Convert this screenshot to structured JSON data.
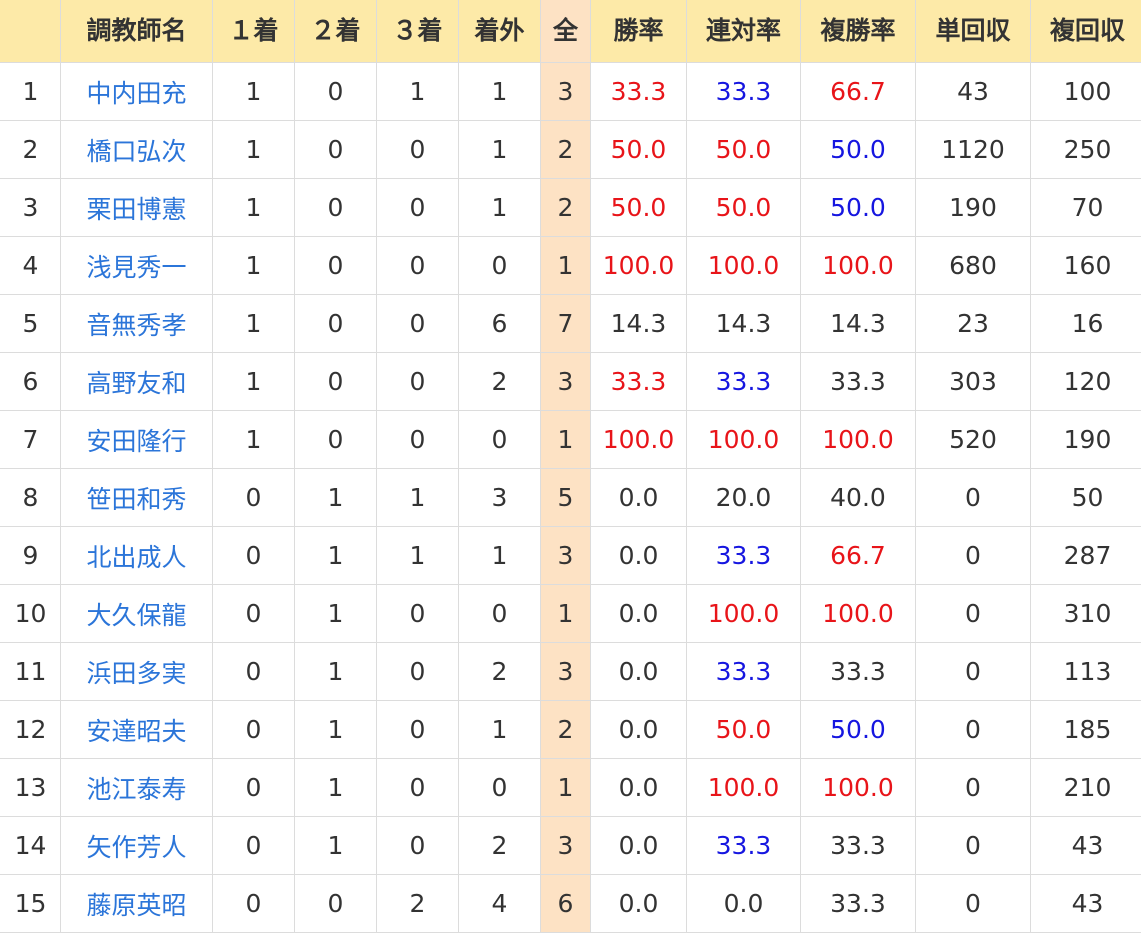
{
  "table": {
    "headers": {
      "rank": "",
      "trainer": "調教師名",
      "first": "１着",
      "second": "２着",
      "third": "３着",
      "out": "着外",
      "total": "全",
      "win_rate": "勝率",
      "quinella_rate": "連対率",
      "place_rate": "複勝率",
      "win_return": "単回収",
      "place_return": "複回収"
    },
    "colors": {
      "header_bg": "#fdeaa8",
      "total_column_bg": "#fde2c4",
      "link": "#2b75d9",
      "red": "#e81419",
      "blue": "#1616e0",
      "text": "#333333"
    },
    "rows": [
      {
        "rank": "1",
        "trainer": "中内田充",
        "first": "1",
        "second": "0",
        "third": "1",
        "out": "1",
        "total": "3",
        "win_rate": "33.3",
        "quinella_rate": "33.3",
        "place_rate": "66.7",
        "win_return": "43",
        "place_return": "100"
      },
      {
        "rank": "2",
        "trainer": "橋口弘次",
        "first": "1",
        "second": "0",
        "third": "0",
        "out": "1",
        "total": "2",
        "win_rate": "50.0",
        "quinella_rate": "50.0",
        "place_rate": "50.0",
        "win_return": "1120",
        "place_return": "250"
      },
      {
        "rank": "3",
        "trainer": "栗田博憲",
        "first": "1",
        "second": "0",
        "third": "0",
        "out": "1",
        "total": "2",
        "win_rate": "50.0",
        "quinella_rate": "50.0",
        "place_rate": "50.0",
        "win_return": "190",
        "place_return": "70"
      },
      {
        "rank": "4",
        "trainer": "浅見秀一",
        "first": "1",
        "second": "0",
        "third": "0",
        "out": "0",
        "total": "1",
        "win_rate": "100.0",
        "quinella_rate": "100.0",
        "place_rate": "100.0",
        "win_return": "680",
        "place_return": "160"
      },
      {
        "rank": "5",
        "trainer": "音無秀孝",
        "first": "1",
        "second": "0",
        "third": "0",
        "out": "6",
        "total": "7",
        "win_rate": "14.3",
        "quinella_rate": "14.3",
        "place_rate": "14.3",
        "win_return": "23",
        "place_return": "16"
      },
      {
        "rank": "6",
        "trainer": "高野友和",
        "first": "1",
        "second": "0",
        "third": "0",
        "out": "2",
        "total": "3",
        "win_rate": "33.3",
        "quinella_rate": "33.3",
        "place_rate": "33.3",
        "win_return": "303",
        "place_return": "120"
      },
      {
        "rank": "7",
        "trainer": "安田隆行",
        "first": "1",
        "second": "0",
        "third": "0",
        "out": "0",
        "total": "1",
        "win_rate": "100.0",
        "quinella_rate": "100.0",
        "place_rate": "100.0",
        "win_return": "520",
        "place_return": "190"
      },
      {
        "rank": "8",
        "trainer": "笹田和秀",
        "first": "0",
        "second": "1",
        "third": "1",
        "out": "3",
        "total": "5",
        "win_rate": "0.0",
        "quinella_rate": "20.0",
        "place_rate": "40.0",
        "win_return": "0",
        "place_return": "50"
      },
      {
        "rank": "9",
        "trainer": "北出成人",
        "first": "0",
        "second": "1",
        "third": "1",
        "out": "1",
        "total": "3",
        "win_rate": "0.0",
        "quinella_rate": "33.3",
        "place_rate": "66.7",
        "win_return": "0",
        "place_return": "287"
      },
      {
        "rank": "10",
        "trainer": "大久保龍",
        "first": "0",
        "second": "1",
        "third": "0",
        "out": "0",
        "total": "1",
        "win_rate": "0.0",
        "quinella_rate": "100.0",
        "place_rate": "100.0",
        "win_return": "0",
        "place_return": "310"
      },
      {
        "rank": "11",
        "trainer": "浜田多実",
        "first": "0",
        "second": "1",
        "third": "0",
        "out": "2",
        "total": "3",
        "win_rate": "0.0",
        "quinella_rate": "33.3",
        "place_rate": "33.3",
        "win_return": "0",
        "place_return": "113"
      },
      {
        "rank": "12",
        "trainer": "安達昭夫",
        "first": "0",
        "second": "1",
        "third": "0",
        "out": "1",
        "total": "2",
        "win_rate": "0.0",
        "quinella_rate": "50.0",
        "place_rate": "50.0",
        "win_return": "0",
        "place_return": "185"
      },
      {
        "rank": "13",
        "trainer": "池江泰寿",
        "first": "0",
        "second": "1",
        "third": "0",
        "out": "0",
        "total": "1",
        "win_rate": "0.0",
        "quinella_rate": "100.0",
        "place_rate": "100.0",
        "win_return": "0",
        "place_return": "210"
      },
      {
        "rank": "14",
        "trainer": "矢作芳人",
        "first": "0",
        "second": "1",
        "third": "0",
        "out": "2",
        "total": "3",
        "win_rate": "0.0",
        "quinella_rate": "33.3",
        "place_rate": "33.3",
        "win_return": "0",
        "place_return": "43"
      },
      {
        "rank": "15",
        "trainer": "藤原英昭",
        "first": "0",
        "second": "0",
        "third": "2",
        "out": "4",
        "total": "6",
        "win_rate": "0.0",
        "quinella_rate": "0.0",
        "place_rate": "33.3",
        "win_return": "0",
        "place_return": "43"
      }
    ],
    "rate_colors": [
      {
        "win_rate": "red",
        "quinella_rate": "blue",
        "place_rate": "red"
      },
      {
        "win_rate": "red",
        "quinella_rate": "red",
        "place_rate": "blue"
      },
      {
        "win_rate": "red",
        "quinella_rate": "red",
        "place_rate": "blue"
      },
      {
        "win_rate": "red",
        "quinella_rate": "red",
        "place_rate": "red"
      },
      {
        "win_rate": "",
        "quinella_rate": "",
        "place_rate": ""
      },
      {
        "win_rate": "red",
        "quinella_rate": "blue",
        "place_rate": ""
      },
      {
        "win_rate": "red",
        "quinella_rate": "red",
        "place_rate": "red"
      },
      {
        "win_rate": "",
        "quinella_rate": "",
        "place_rate": ""
      },
      {
        "win_rate": "",
        "quinella_rate": "blue",
        "place_rate": "red"
      },
      {
        "win_rate": "",
        "quinella_rate": "red",
        "place_rate": "red"
      },
      {
        "win_rate": "",
        "quinella_rate": "blue",
        "place_rate": ""
      },
      {
        "win_rate": "",
        "quinella_rate": "red",
        "place_rate": "blue"
      },
      {
        "win_rate": "",
        "quinella_rate": "red",
        "place_rate": "red"
      },
      {
        "win_rate": "",
        "quinella_rate": "blue",
        "place_rate": ""
      },
      {
        "win_rate": "",
        "quinella_rate": "",
        "place_rate": ""
      }
    ]
  }
}
